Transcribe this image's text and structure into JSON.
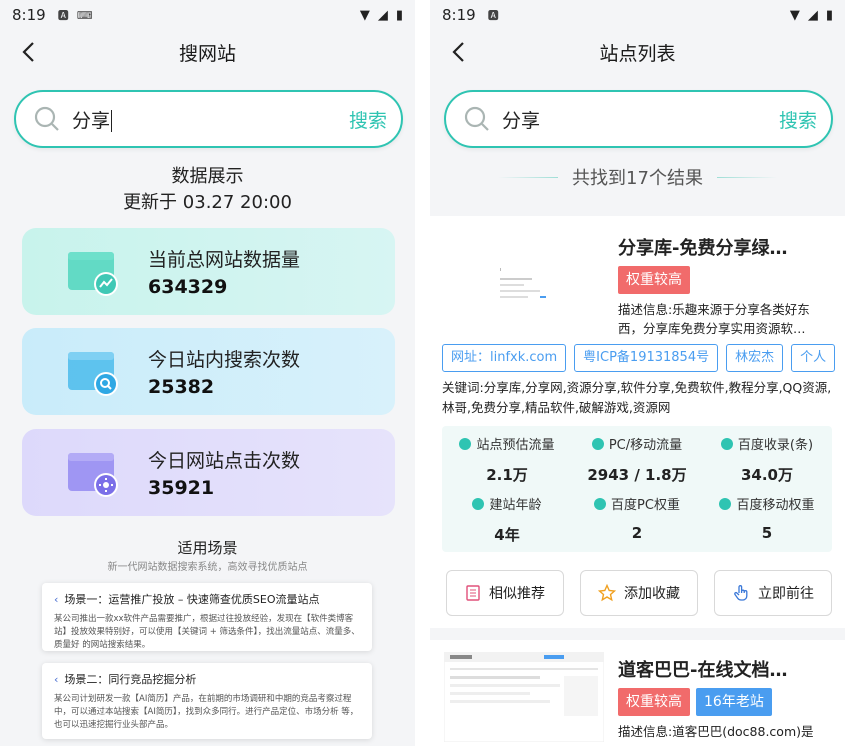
{
  "left": {
    "status": {
      "time": "8:19"
    },
    "title": "搜网站",
    "search": {
      "query": "分享",
      "button": "搜索"
    },
    "data_head": {
      "title": "数据展示",
      "updated": "更新于 03.27 20:00"
    },
    "cards": [
      {
        "label": "当前总网站数据量",
        "value": "634329"
      },
      {
        "label": "今日站内搜索次数",
        "value": "25382"
      },
      {
        "label": "今日网站点击次数",
        "value": "35921"
      }
    ],
    "scenes": {
      "title": "适用场景",
      "subtitle": "新一代网站数据搜索系统，高效寻找优质站点",
      "items": [
        {
          "title": "场景一：运营推广投放 – 快速筛查优质SEO流量站点",
          "body": "某公司推出一款xx软件产品需要推广，根据过往投放经验，发现在【软件类博客站】投放效果特别好，可以使用【关键词 + 筛选条件】，找出流量站点、流量多、质量好 的网站搜索结果。"
        },
        {
          "title": "场景二：同行竞品挖掘分析",
          "body": "某公司计划研发一款【AI简历】产品，在前期的市场调研和中期的竞品考察过程中，可以通过本站搜索【AI简历】，找到众多同行。进行产品定位、市场分析 等，也可以迅速挖掘行业头部产品。"
        }
      ]
    }
  },
  "right": {
    "status": {
      "time": "8:19"
    },
    "title": "站点列表",
    "search": {
      "query": "分享",
      "button": "搜索"
    },
    "result_count": "共找到17个结果",
    "items": [
      {
        "title": "分享库-免费分享绿…",
        "tags": [
          "权重较高"
        ],
        "desc": "描述信息:乐趣来源于分享各类好东西，分享库免费分享实用资源软…",
        "pills": [
          "网址：linfxk.com",
          "粤ICP备19131854号",
          "林宏杰",
          "个人"
        ],
        "keywords": "关键词:分享库,分享网,资源分享,软件分享,免费软件,教程分享,QQ资源,林哥,免费分享,精品软件,破解游戏,资源网",
        "stats": [
          {
            "label": "站点预估流量",
            "value": "2.1万"
          },
          {
            "label": "PC/移动流量",
            "value": "2943 / 1.8万"
          },
          {
            "label": "百度收录(条)",
            "value": "34.0万"
          },
          {
            "label": "建站年龄",
            "value": "4年"
          },
          {
            "label": "百度PC权重",
            "value": "2"
          },
          {
            "label": "百度移动权重",
            "value": "5"
          }
        ],
        "buttons": [
          "相似推荐",
          "添加收藏",
          "立即前往"
        ]
      },
      {
        "title": "道客巴巴-在线文档…",
        "tags": [
          "权重较高",
          "16年老站"
        ],
        "desc": "描述信息:道客巴巴(doc88.com)是"
      }
    ]
  },
  "colors": {
    "accent": "#2fc4b2",
    "tag_red": "#f16b6b",
    "tag_blue": "#4a9df0"
  }
}
